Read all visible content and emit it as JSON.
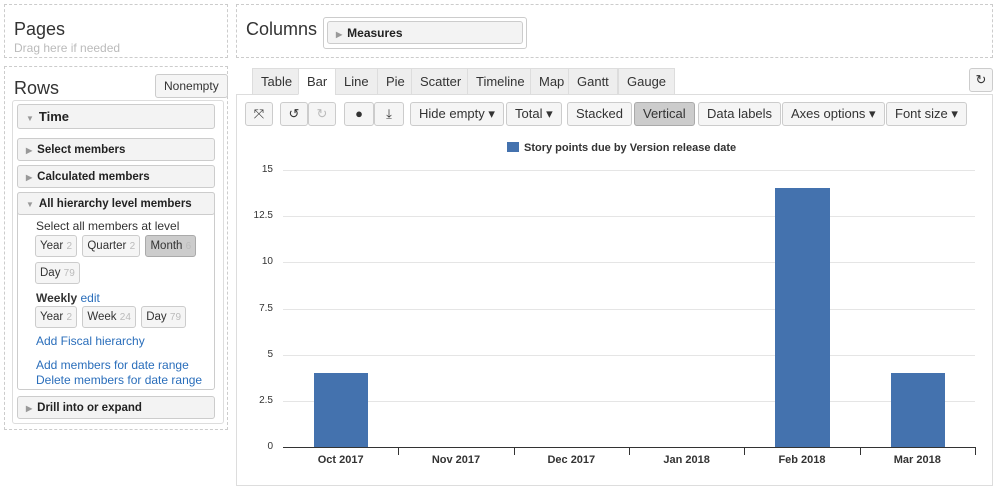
{
  "pages": {
    "title": "Pages",
    "hint": "Drag here if needed"
  },
  "columns": {
    "title": "Columns",
    "measures": "Measures"
  },
  "rows": {
    "title": "Rows",
    "nonempty": "Nonempty",
    "time": "Time",
    "select_members": "Select members",
    "calculated_members": "Calculated members",
    "all_hierarchy": "All hierarchy level members",
    "select_all_label": "Select all members at level",
    "levels": [
      {
        "label": "Year",
        "count": "2"
      },
      {
        "label": "Quarter",
        "count": "2"
      },
      {
        "label": "Month",
        "count": "6"
      },
      {
        "label": "Day",
        "count": "79"
      }
    ],
    "weekly": "Weekly",
    "edit": "edit",
    "weekly_levels": [
      {
        "label": "Year",
        "count": "2"
      },
      {
        "label": "Week",
        "count": "24"
      },
      {
        "label": "Day",
        "count": "79"
      }
    ],
    "add_fiscal": "Add Fiscal hierarchy",
    "add_range": "Add members for date range",
    "delete_range": "Delete members for date range",
    "drill": "Drill into or expand"
  },
  "tabs": [
    "Table",
    "Bar",
    "Line",
    "Pie",
    "Scatter",
    "Timeline",
    "Map",
    "Gantt",
    "Gauge"
  ],
  "toolbar": {
    "hide_empty": "Hide empty",
    "total": "Total",
    "stacked": "Stacked",
    "vertical": "Vertical",
    "data_labels": "Data labels",
    "axes_options": "Axes options",
    "font_size": "Font size"
  },
  "colors": {
    "bar": "#4472ae"
  },
  "chart_data": {
    "type": "bar",
    "categories": [
      "Oct 2017",
      "Nov 2017",
      "Dec 2017",
      "Jan 2018",
      "Feb 2018",
      "Mar 2018"
    ],
    "series": [
      {
        "name": "Story points due by Version release date",
        "values": [
          4,
          0,
          0,
          0,
          14,
          4
        ]
      }
    ],
    "yticks": [
      "0",
      "2.5",
      "5",
      "7.5",
      "10",
      "12.5",
      "15"
    ],
    "ylim": [
      0,
      15
    ],
    "legend": "top"
  }
}
